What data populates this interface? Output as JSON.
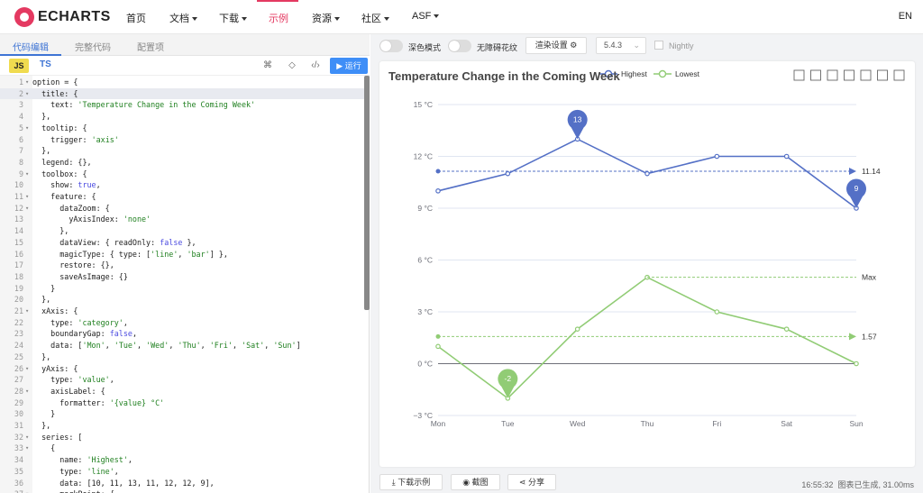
{
  "nav": {
    "logo_text": "ECHARTS",
    "items": [
      "首页",
      "文档",
      "下载",
      "示例",
      "资源",
      "社区",
      "ASF"
    ],
    "lang": "EN"
  },
  "editor": {
    "tabs": [
      "代码编辑",
      "完整代码",
      "配置项"
    ],
    "lang_js": "JS",
    "lang_ts": "TS",
    "run_label": "运行",
    "lines": [
      "option = {",
      "  title: {",
      "    text: 'Temperature Change in the Coming Week'",
      "  },",
      "  tooltip: {",
      "    trigger: 'axis'",
      "  },",
      "  legend: {},",
      "  toolbox: {",
      "    show: true,",
      "    feature: {",
      "      dataZoom: {",
      "        yAxisIndex: 'none'",
      "      },",
      "      dataView: { readOnly: false },",
      "      magicType: { type: ['line', 'bar'] },",
      "      restore: {},",
      "      saveAsImage: {}",
      "    }",
      "  },",
      "  xAxis: {",
      "    type: 'category',",
      "    boundaryGap: false,",
      "    data: ['Mon', 'Tue', 'Wed', 'Thu', 'Fri', 'Sat', 'Sun']",
      "  },",
      "  yAxis: {",
      "    type: 'value',",
      "    axisLabel: {",
      "      formatter: '{value} °C'",
      "    }",
      "  },",
      "  series: [",
      "    {",
      "      name: 'Highest',",
      "      type: 'line',",
      "      data: [10, 11, 13, 11, 12, 12, 9],",
      "      markPoint: {"
    ],
    "fold_lines": [
      1,
      2,
      5,
      9,
      11,
      12,
      21,
      26,
      28,
      32,
      33,
      37
    ]
  },
  "controls": {
    "dark_mode": "深色模式",
    "accessible": "无障碍花纹",
    "render_settings": "渲染设置",
    "version": "5.4.3",
    "nightly": "Nightly"
  },
  "footer": {
    "download": "下载示例",
    "screenshot": "截图",
    "share": "分享",
    "time": "16:55:32",
    "info": "图表已生成, 31.00ms"
  },
  "colors": {
    "highest": "#5470c6",
    "lowest": "#91cc75",
    "accent": "#e43961"
  },
  "chart_data": {
    "type": "line",
    "title": "Temperature Change in the Coming Week",
    "categories": [
      "Mon",
      "Tue",
      "Wed",
      "Thu",
      "Fri",
      "Sat",
      "Sun"
    ],
    "series": [
      {
        "name": "Highest",
        "values": [
          10,
          11,
          13,
          11,
          12,
          12,
          9
        ],
        "max": 13,
        "min": 9,
        "average": 11.14
      },
      {
        "name": "Lowest",
        "values": [
          1,
          -2,
          2,
          5,
          3,
          2,
          0
        ],
        "min": -2,
        "average": 1.57,
        "max_line_label": "Max"
      }
    ],
    "y_ticks": [
      "15 °C",
      "12 °C",
      "9 °C",
      "6 °C",
      "3 °C",
      "0 °C",
      "−3 °C"
    ],
    "ylim": [
      -3,
      15
    ],
    "legend_position": "top-center",
    "grid": true
  }
}
